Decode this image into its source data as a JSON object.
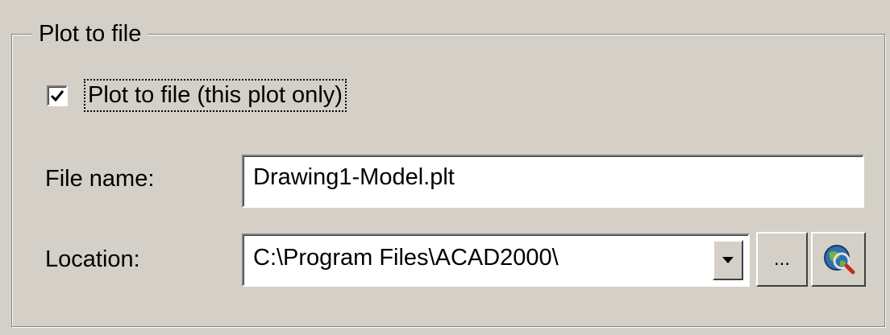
{
  "group": {
    "title": "Plot to file"
  },
  "checkbox": {
    "label": "Plot to file (this plot only)",
    "checked": true
  },
  "file_name": {
    "label": "File name:",
    "value": "Drawing1-Model.plt"
  },
  "location": {
    "label": "Location:",
    "value": "C:\\Program Files\\ACAD2000\\"
  },
  "buttons": {
    "browse_label": "...",
    "web_icon": "globe-search-icon"
  },
  "colors": {
    "dialog_bg": "#d4d0c8",
    "field_bg": "#ffffff",
    "border_dark": "#808080"
  }
}
